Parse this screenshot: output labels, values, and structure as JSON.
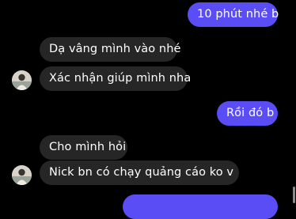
{
  "messages": [
    {
      "text": "10 phút nhé b",
      "sender": "me"
    },
    {
      "text": "Dạ vâng mình vào nhé",
      "sender": "contact"
    },
    {
      "text": "Xác nhận giúp mình nha",
      "sender": "contact",
      "show_avatar": true
    },
    {
      "text": "Rồi đó b",
      "sender": "me"
    },
    {
      "text": "Cho mình hỏi",
      "sender": "contact"
    },
    {
      "text": "Nick bn có chạy quảng cáo ko v",
      "sender": "contact",
      "show_avatar": true
    },
    {
      "text": "",
      "sender": "me"
    }
  ],
  "colors": {
    "outgoing_bubble": "#5b4df5",
    "incoming_bubble": "#262626",
    "background": "#000000"
  },
  "icons": {
    "avatar": "contact-avatar-photo"
  }
}
